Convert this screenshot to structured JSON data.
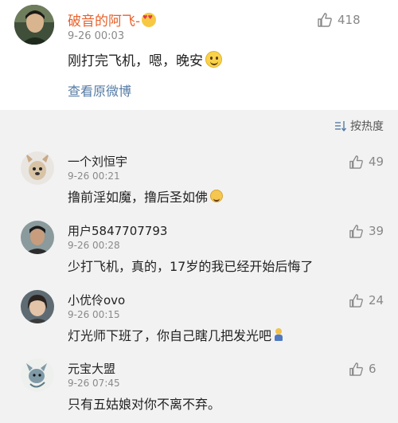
{
  "post": {
    "author": "破音的阿飞-",
    "time": "9-26 00:03",
    "likes": "418",
    "text": "刚打完飞机，嗯，晚安",
    "view_original": "查看原微博"
  },
  "sort": {
    "label": "按热度"
  },
  "comments": [
    {
      "author": "一个刘恒宇",
      "time": "9-26 00:21",
      "likes": "49",
      "text": "撸前淫如魔，撸后圣如佛"
    },
    {
      "author": "用户5847707793",
      "time": "9-26 00:28",
      "likes": "39",
      "text": "少打飞机，真的，17岁的我已经开始后悔了"
    },
    {
      "author": "小优伶ovo",
      "time": "9-26 00:15",
      "likes": "24",
      "text": "灯光师下班了，你自己瞎几把发光吧"
    },
    {
      "author": "元宝大盟",
      "time": "9-26 07:45",
      "likes": "6",
      "text": "只有五姑娘对你不离不弃。"
    }
  ],
  "colors": {
    "author_accent": "#e8612c",
    "link": "#567ca6",
    "muted": "#8a8a8a",
    "background": "#f2f2f2"
  },
  "icons": [
    "thumbs-up-icon",
    "sort-icon",
    "smile-emoji-icon",
    "heart-eyes-emoji-icon"
  ]
}
